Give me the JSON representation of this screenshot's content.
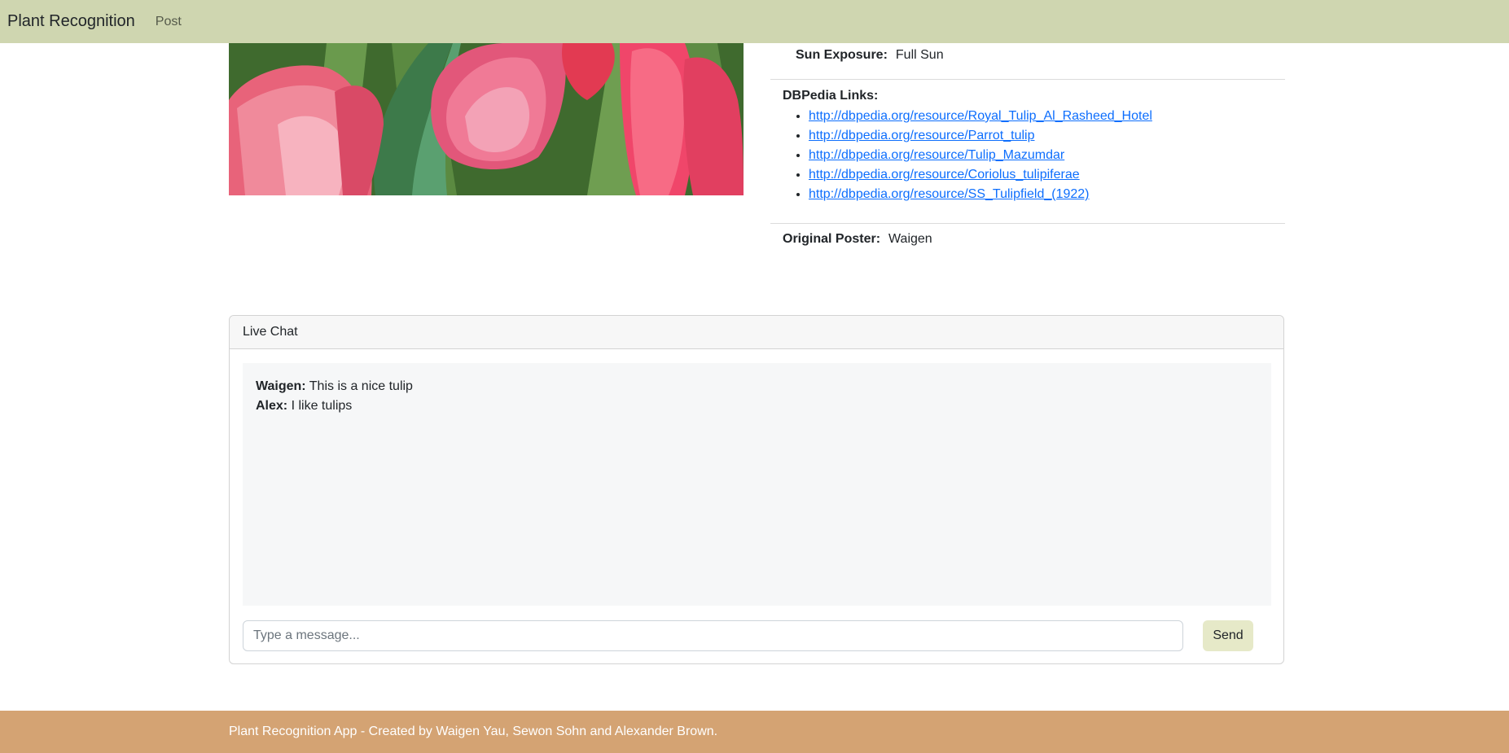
{
  "navbar": {
    "brand": "Plant Recognition",
    "links": [
      "Post"
    ]
  },
  "plant": {
    "image_alt": "tulips-photo",
    "sun_exposure_label": "Sun Exposure:",
    "sun_exposure_value": "Full Sun",
    "dbpedia_label": "DBPedia Links:",
    "dbpedia_links": [
      "http://dbpedia.org/resource/Royal_Tulip_Al_Rasheed_Hotel",
      "http://dbpedia.org/resource/Parrot_tulip",
      "http://dbpedia.org/resource/Tulip_Mazumdar",
      "http://dbpedia.org/resource/Coriolus_tulipiferae",
      "http://dbpedia.org/resource/SS_Tulipfield_(1922)"
    ],
    "poster_label": "Original Poster:",
    "poster_value": "Waigen"
  },
  "chat": {
    "header": "Live Chat",
    "messages": [
      {
        "user": "Waigen:",
        "text": "This is a nice tulip"
      },
      {
        "user": "Alex:",
        "text": "I like tulips"
      }
    ],
    "input_placeholder": "Type a message...",
    "send_label": "Send"
  },
  "footer": {
    "text": "Plant Recognition App - Created by Waigen Yau, Sewon Sohn and Alexander Brown."
  },
  "colors": {
    "navbar_bg": "#cfd6b0",
    "footer_bg": "#d4a373",
    "send_bg": "#e6e9c8",
    "link": "#0d6efd"
  }
}
